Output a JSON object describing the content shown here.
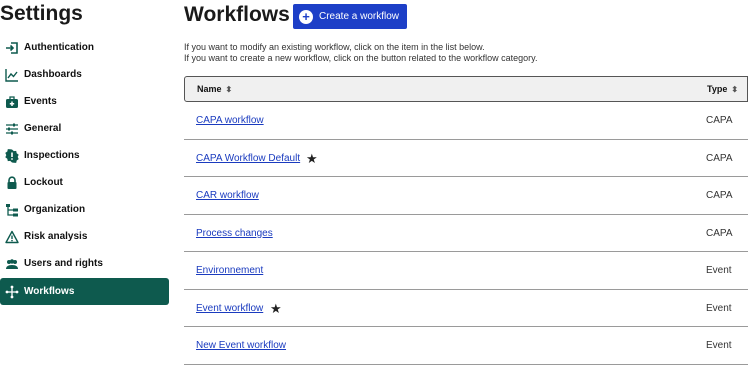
{
  "sidebar": {
    "title": "Settings",
    "items": [
      {
        "label": "Authentication",
        "icon": "sign-in-icon"
      },
      {
        "label": "Dashboards",
        "icon": "line-chart-icon"
      },
      {
        "label": "Events",
        "icon": "medkit-icon"
      },
      {
        "label": "General",
        "icon": "sliders-icon"
      },
      {
        "label": "Inspections",
        "icon": "alert-badge-icon"
      },
      {
        "label": "Lockout",
        "icon": "lock-icon"
      },
      {
        "label": "Organization",
        "icon": "hierarchy-icon"
      },
      {
        "label": "Risk analysis",
        "icon": "warning-triangle-icon"
      },
      {
        "label": "Users and rights",
        "icon": "users-icon"
      },
      {
        "label": "Workflows",
        "icon": "workflow-icon",
        "active": true
      }
    ],
    "active_color": "#0e5a4e"
  },
  "main": {
    "title": "Workflows",
    "create_button": "Create a workflow",
    "intro_line1": "If you want to modify an existing workflow, click on the item in the list below.",
    "intro_line2": "If you want to create a new workflow, click on the button related to the workflow category.",
    "table": {
      "columns": [
        "Name",
        "Type"
      ],
      "rows": [
        {
          "name": "CAPA workflow",
          "type": "CAPA",
          "default": false
        },
        {
          "name": "CAPA Workflow Default ",
          "type": "CAPA",
          "default": true
        },
        {
          "name": "CAR workflow",
          "type": "CAPA",
          "default": false
        },
        {
          "name": "Process changes",
          "type": "CAPA",
          "default": false
        },
        {
          "name": "Environnement",
          "type": "Event",
          "default": false
        },
        {
          "name": "Event workflow ",
          "type": "Event",
          "default": true
        },
        {
          "name": "New Event workflow",
          "type": "Event",
          "default": false
        }
      ]
    },
    "button_color": "#1d3fc7",
    "link_color": "#1a3bbf"
  }
}
